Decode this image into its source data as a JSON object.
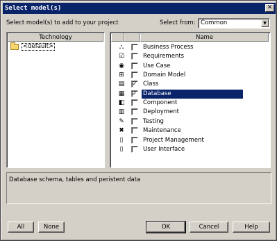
{
  "window": {
    "title": "Select model(s)",
    "close_glyph": "✕"
  },
  "prompt": {
    "instruction": "Select model(s) to add to your project",
    "select_from_label": "Select from:"
  },
  "select_from": {
    "value": "Common",
    "arrow": "▼"
  },
  "technology": {
    "header": "Technology",
    "items": [
      {
        "label": "<default>",
        "icon": "folder-icon"
      }
    ]
  },
  "models": {
    "header": "Name",
    "items": [
      {
        "label": "Business Process",
        "checked": false,
        "selected": false,
        "icon": "business-process-icon",
        "glyph": "⛬"
      },
      {
        "label": "Requirements",
        "checked": false,
        "selected": false,
        "icon": "requirements-icon",
        "glyph": "☑"
      },
      {
        "label": "Use Case",
        "checked": false,
        "selected": false,
        "icon": "use-case-icon",
        "glyph": "◉"
      },
      {
        "label": "Domain Model",
        "checked": false,
        "selected": false,
        "icon": "domain-model-icon",
        "glyph": "⊞"
      },
      {
        "label": "Class",
        "checked": true,
        "selected": false,
        "icon": "class-icon",
        "glyph": "▤"
      },
      {
        "label": "Database",
        "checked": true,
        "selected": true,
        "icon": "database-icon",
        "glyph": "▦"
      },
      {
        "label": "Component",
        "checked": false,
        "selected": false,
        "icon": "component-icon",
        "glyph": "◧"
      },
      {
        "label": "Deployment",
        "checked": false,
        "selected": false,
        "icon": "deployment-icon",
        "glyph": "▥"
      },
      {
        "label": "Testing",
        "checked": false,
        "selected": false,
        "icon": "testing-icon",
        "glyph": "✎"
      },
      {
        "label": "Maintenance",
        "checked": false,
        "selected": false,
        "icon": "maintenance-icon",
        "glyph": "✖"
      },
      {
        "label": "Project Management",
        "checked": false,
        "selected": false,
        "icon": "project-management-icon",
        "glyph": "▯"
      },
      {
        "label": "User Interface",
        "checked": false,
        "selected": false,
        "icon": "user-interface-icon",
        "glyph": "▯"
      }
    ]
  },
  "description": "Database schema, tables and peristent data",
  "buttons": {
    "all": "All",
    "none": "None",
    "ok": "OK",
    "cancel": "Cancel",
    "help": "Help"
  },
  "colors": {
    "title_bar": "#0a246a",
    "selection": "#0a246a",
    "face": "#d4d0c8"
  }
}
